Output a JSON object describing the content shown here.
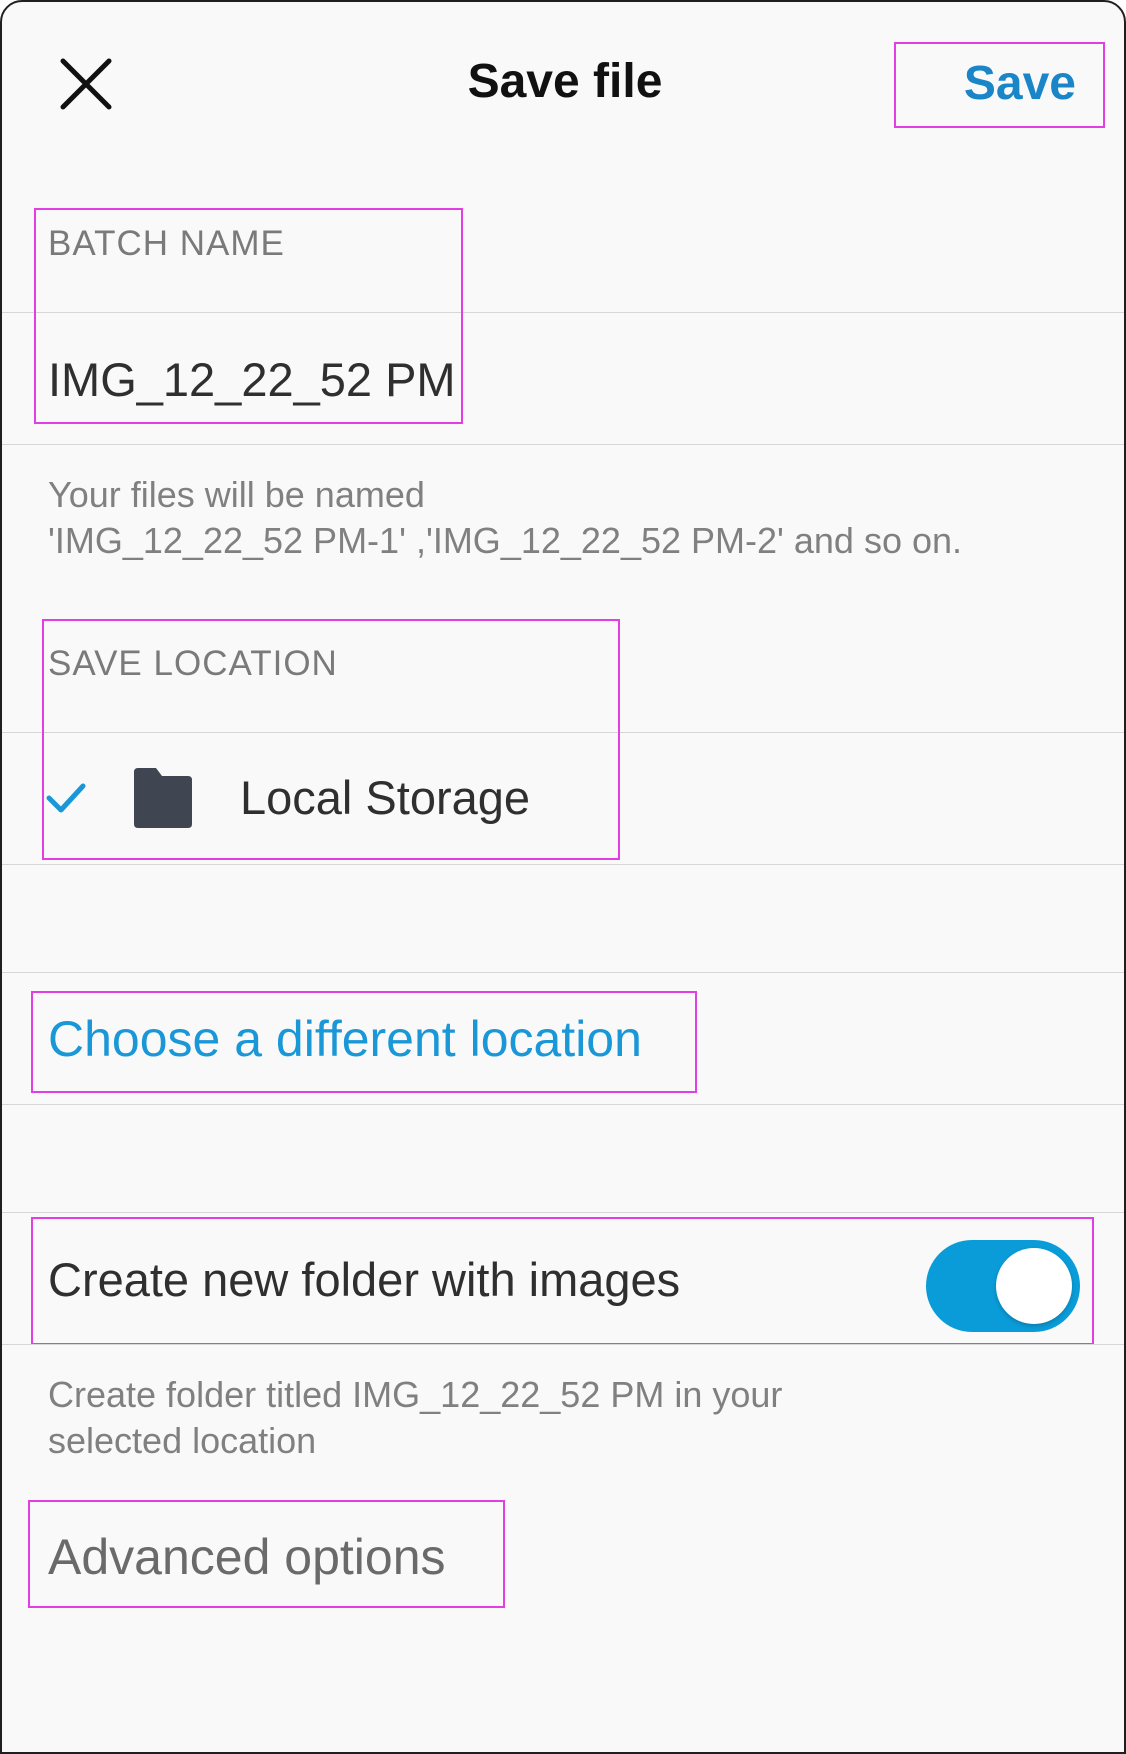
{
  "header": {
    "title": "Save file",
    "save_label": "Save",
    "close_icon": "close-icon"
  },
  "batch_name": {
    "section_label": "BATCH NAME",
    "value": "IMG_12_22_52 PM",
    "hint_line1": "Your files will be named",
    "hint_line2": "'IMG_12_22_52 PM-1' ,'IMG_12_22_52 PM-2' and so on."
  },
  "save_location": {
    "section_label": "SAVE LOCATION",
    "selected_location": "Local Storage",
    "check_icon": "checkmark-icon",
    "folder_icon": "folder-icon",
    "choose_link": "Choose a different location"
  },
  "create_folder": {
    "label": "Create new folder with images",
    "enabled": true,
    "hint_line1": "Create folder titled IMG_12_22_52 PM in your",
    "hint_line2": "selected location"
  },
  "advanced_options_label": "Advanced options",
  "colors": {
    "accent": "#1a97d6",
    "save_button": "#1a86c7",
    "toggle_on": "#0a9cd8",
    "background": "#f9f9f9",
    "folder_icon": "#3f4652"
  }
}
